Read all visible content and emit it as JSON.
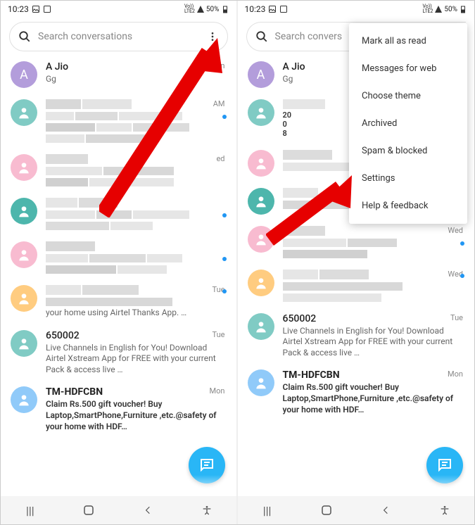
{
  "status": {
    "time": "10:23",
    "battery": "50%",
    "net": "Vo)) LTE2"
  },
  "search": {
    "placeholder": "Search conversations"
  },
  "search_right": {
    "placeholder": "Search convers"
  },
  "conversations": [
    {
      "name": "A Jio",
      "preview": "Gg",
      "time": "24 min",
      "avatar": "purple",
      "letter": "A",
      "dot": false
    },
    {
      "name": "",
      "preview": "",
      "time": "AM",
      "avatar": "green",
      "dot": true,
      "pixelated": true
    },
    {
      "name": "",
      "preview": "",
      "time": "ed",
      "avatar": "pink",
      "dot": false,
      "pixelated": true
    },
    {
      "name": "",
      "preview": "",
      "time": "",
      "avatar": "teal",
      "dot": true,
      "pixelated": true
    },
    {
      "name": "",
      "preview": "",
      "time": "",
      "avatar": "pink",
      "dot": true,
      "pixelated": true
    },
    {
      "name": "",
      "preview": "your home using Airtel Thanks App. …",
      "time": "Tue",
      "avatar": "orange",
      "dot": true,
      "pixelated_name": true
    },
    {
      "name": "650002",
      "preview": "Live Channels in English for You! Download Airtel Xstream App for FREE with your current Pack & access live …",
      "time": "Tue",
      "avatar": "green",
      "dot": false
    },
    {
      "name": "TM-HDFCBN",
      "preview": "Claim Rs.500 gift voucher! Buy Laptop,SmartPhone,Furniture ,etc.@safety of your home with HDF…",
      "time": "Mon",
      "avatar": "blue",
      "dot": false
    }
  ],
  "conversations_right": [
    {
      "name": "A Jio",
      "preview": "Gg",
      "time": "",
      "avatar": "purple",
      "letter": "A"
    },
    {
      "name": "",
      "preview_lines": [
        "20",
        "0",
        "8"
      ],
      "time": "",
      "avatar": "green",
      "pixelated": true
    },
    {
      "name": "",
      "preview": "",
      "time": "",
      "avatar": "pink",
      "pixelated": true
    },
    {
      "name": "",
      "preview": "",
      "time": "",
      "avatar": "teal",
      "pixelated": true
    },
    {
      "name": "",
      "preview": "",
      "time": "Wed",
      "avatar": "pink",
      "dot": true,
      "pixelated": true
    },
    {
      "name": "",
      "preview": "",
      "time": "Wed",
      "avatar": "orange",
      "dot": true,
      "pixelated_name": true
    },
    {
      "name": "650002",
      "preview": "Live Channels in English for You! Download Airtel Xstream App for FREE with your current Pack & access live …",
      "time": "Tue",
      "avatar": "green"
    },
    {
      "name": "TM-HDFCBN",
      "preview": "Claim Rs.500 gift voucher! Buy Laptop,SmartPhone,Furniture ,etc.@safety of your home with HDF…",
      "time": "Mon",
      "avatar": "blue"
    }
  ],
  "menu": {
    "items": [
      "Mark all as read",
      "Messages for web",
      "Choose theme",
      "Archived",
      "Spam & blocked",
      "Settings",
      "Help & feedback"
    ]
  }
}
